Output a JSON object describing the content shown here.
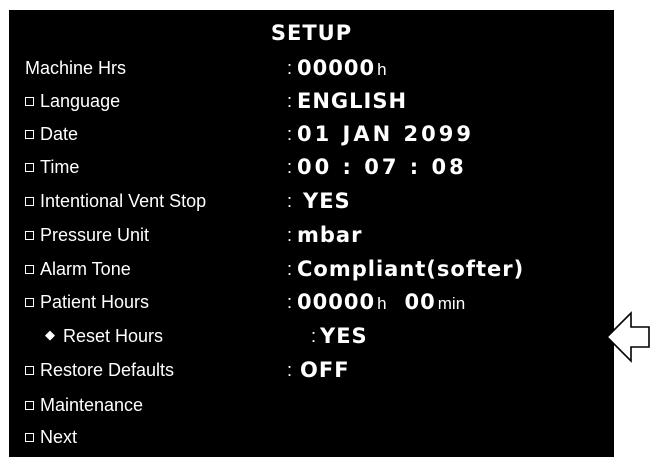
{
  "setup": {
    "title": "SETUP",
    "machine_hrs": {
      "label": "Machine Hrs",
      "value": "00000",
      "unit": "h"
    },
    "language": {
      "label": "Language",
      "value": "ENGLISH"
    },
    "date": {
      "label": "Date",
      "value": "01 JAN 2099"
    },
    "time": {
      "label": "Time",
      "value": "00 : 07 : 08"
    },
    "intentional_vent_stop": {
      "label": "Intentional Vent Stop",
      "value": "YES"
    },
    "pressure_unit": {
      "label": "Pressure Unit",
      "value": "mbar"
    },
    "alarm_tone": {
      "label": "Alarm Tone",
      "value": "Compliant(softer)"
    },
    "patient_hours": {
      "label": "Patient Hours",
      "hours": "00000",
      "hours_unit": "h",
      "minutes": "00",
      "minutes_unit": "min"
    },
    "reset_hours": {
      "label": "Reset Hours",
      "value": "YES"
    },
    "restore_defaults": {
      "label": "Restore Defaults",
      "value": "OFF"
    },
    "maintenance": {
      "label": "Maintenance"
    },
    "next": {
      "label": "Next"
    },
    "separator": ":"
  },
  "icons": {
    "menu_bullet": "checkbox-square-icon",
    "submenu_bullet": "diamond-icon",
    "pointer": "left-arrow-icon"
  },
  "colors": {
    "screen_background": "#000000",
    "text": "#ffffff",
    "page_background": "#ffffff"
  }
}
